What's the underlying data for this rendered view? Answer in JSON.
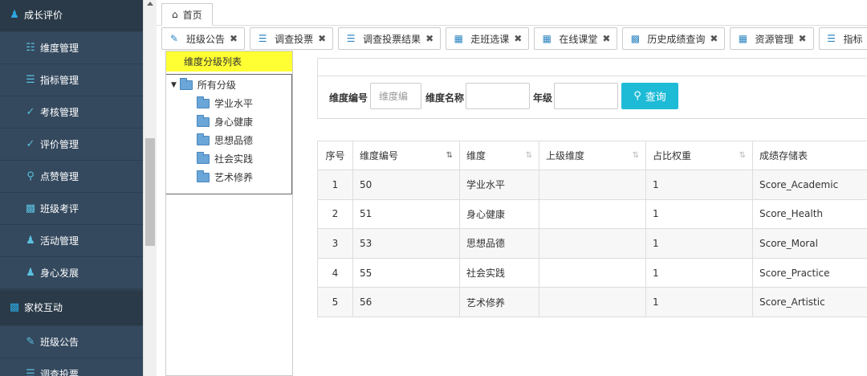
{
  "sidebar": {
    "group1": {
      "label": "成长评价",
      "icon": "person-icon"
    },
    "items1": [
      {
        "label": "维度管理",
        "icon": "sitemap-icon"
      },
      {
        "label": "指标管理",
        "icon": "list-icon"
      },
      {
        "label": "考核管理",
        "icon": "check-icon"
      },
      {
        "label": "评价管理",
        "icon": "check-icon"
      },
      {
        "label": "点赞管理",
        "icon": "location-pin-icon"
      },
      {
        "label": "班级考评",
        "icon": "bar-chart-icon"
      },
      {
        "label": "活动管理",
        "icon": "users-icon"
      },
      {
        "label": "身心发展",
        "icon": "person-icon"
      }
    ],
    "group2": {
      "label": "家校互动",
      "icon": "bar-chart-icon"
    },
    "items2": [
      {
        "label": "班级公告",
        "icon": "edit-icon"
      },
      {
        "label": "调查投票",
        "icon": "list-icon"
      }
    ]
  },
  "home_tab": {
    "label": "首页"
  },
  "tabs": [
    {
      "label": "班级公告",
      "icon": "edit-icon"
    },
    {
      "label": "调查投票",
      "icon": "list-icon"
    },
    {
      "label": "调查投票结果",
      "icon": "list-icon"
    },
    {
      "label": "走班选课",
      "icon": "grid-icon"
    },
    {
      "label": "在线课堂",
      "icon": "calculator-icon"
    },
    {
      "label": "历史成绩查询",
      "icon": "bar-chart-icon"
    },
    {
      "label": "资源管理",
      "icon": "grid-icon"
    },
    {
      "label": "指标",
      "icon": "list-icon"
    }
  ],
  "tree": {
    "header": "维度分级列表",
    "root": "所有分级",
    "children": [
      "学业水平",
      "身心健康",
      "思想品德",
      "社会实践",
      "艺术修养"
    ]
  },
  "search": {
    "code_label": "维度编号",
    "code_placeholder": "维度编",
    "name_label": "维度名称",
    "name_value": "",
    "grade_label": "年级",
    "grade_value": "",
    "query_label": "查询"
  },
  "table": {
    "columns": [
      "序号",
      "维度编号",
      "维度",
      "上级维度",
      "占比权重",
      "成绩存储表"
    ],
    "rows": [
      [
        "1",
        "50",
        "学业水平",
        "",
        "1",
        "Score_Academic"
      ],
      [
        "2",
        "51",
        "身心健康",
        "",
        "1",
        "Score_Health"
      ],
      [
        "3",
        "53",
        "思想品德",
        "",
        "1",
        "Score_Moral"
      ],
      [
        "4",
        "55",
        "社会实践",
        "",
        "1",
        "Score_Practice"
      ],
      [
        "5",
        "56",
        "艺术修养",
        "",
        "1",
        "Score_Artistic"
      ]
    ]
  },
  "colors": {
    "sidebar_bg": "#2f4050",
    "accent": "#1ebbd7",
    "tree_header": "#ffff33"
  }
}
